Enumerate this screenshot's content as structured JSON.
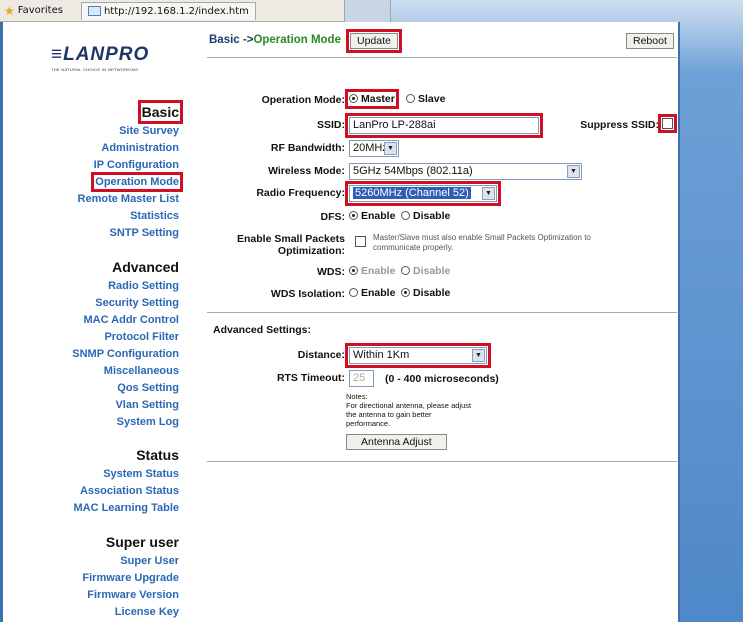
{
  "browser": {
    "favorites_label": "Favorites",
    "tab_url": "http://192.168.1.2/index.htm"
  },
  "logo": {
    "text": "≡LANPRO",
    "tagline": "THE NATURAL CHOICE IN NETWORKING"
  },
  "sidebar": {
    "basic": {
      "heading": "Basic",
      "items": [
        "Site Survey",
        "Administration",
        "IP Configuration",
        "Operation Mode",
        "Remote Master List",
        "Statistics",
        "SNTP Setting"
      ]
    },
    "advanced": {
      "heading": "Advanced",
      "items": [
        "Radio Setting",
        "Security Setting",
        "MAC Addr Control",
        "Protocol Filter",
        "SNMP Configuration",
        "Miscellaneous",
        "Qos Setting",
        "Vlan Setting",
        "System Log"
      ]
    },
    "status": {
      "heading": "Status",
      "items": [
        "System Status",
        "Association Status",
        "MAC Learning Table"
      ]
    },
    "superuser": {
      "heading": "Super user",
      "items": [
        "Super User",
        "Firmware Upgrade",
        "Firmware Version",
        "License Key"
      ]
    }
  },
  "header": {
    "breadcrumb_prefix": "Basic ->",
    "breadcrumb_current": "Operation Mode",
    "update_label": "Update",
    "reboot_label": "Reboot"
  },
  "form": {
    "operation_mode": {
      "label": "Operation Mode:",
      "options": [
        "Master",
        "Slave"
      ],
      "selected": "Master"
    },
    "ssid": {
      "label": "SSID:",
      "value": "LanPro LP-288ai"
    },
    "suppress_ssid": {
      "label": "Suppress SSID:",
      "checked": false
    },
    "rf_bandwidth": {
      "label": "RF Bandwidth:",
      "value": "20MHz"
    },
    "wireless_mode": {
      "label": "Wireless Mode:",
      "value": "5GHz 54Mbps (802.11a)"
    },
    "radio_frequency": {
      "label": "Radio Frequency:",
      "value": "5260MHz (Channel 52)"
    },
    "dfs": {
      "label": "DFS:",
      "options": [
        "Enable",
        "Disable"
      ],
      "selected": "Enable"
    },
    "small_packets": {
      "label_line1": "Enable Small Packets",
      "label_line2": "Optimization:",
      "note_line1": "Master/Slave must also enable Small Packets Optimization to",
      "note_line2": "communicate properly.",
      "checked": false
    },
    "wds": {
      "label": "WDS:",
      "options": [
        "Enable",
        "Disable"
      ],
      "selected": "Enable"
    },
    "wds_isolation": {
      "label": "WDS Isolation:",
      "options": [
        "Enable",
        "Disable"
      ],
      "selected": "Disable"
    }
  },
  "advanced_settings": {
    "heading": "Advanced Settings:",
    "distance": {
      "label": "Distance:",
      "value": "Within 1Km"
    },
    "rts_timeout": {
      "label": "RTS Timeout:",
      "value": "25",
      "range": "(0 - 400 microseconds)"
    },
    "notes": {
      "line1": "Notes:",
      "line2": "For directional antenna, please adjust",
      "line3": "the antenna to gain better",
      "line4": "performance."
    },
    "antenna_button": "Antenna Adjust"
  }
}
